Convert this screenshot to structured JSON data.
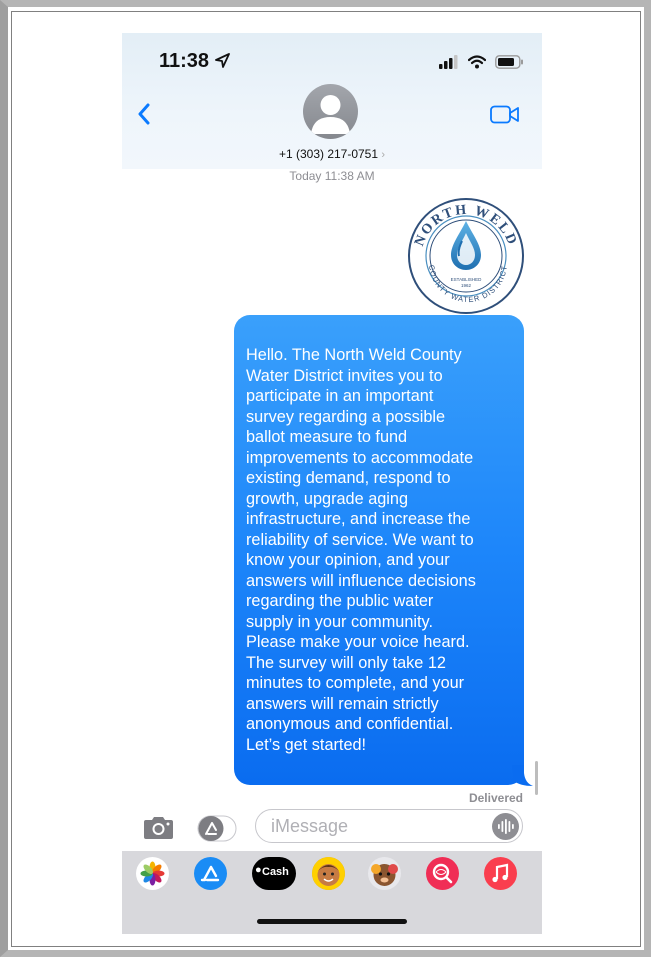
{
  "status_bar": {
    "time": "11:38"
  },
  "header": {
    "contact_number": "+1 (303) 217-0751",
    "chevron": "›"
  },
  "conversation": {
    "timestamp": "Today 11:38 AM",
    "logo": {
      "top_text": "NORTH WELD",
      "bottom_text": "COUNTY WATER DISTRICT",
      "established": "ESTABLISHED",
      "year": "1962",
      "colors": {
        "ring": "#2f4f7a",
        "drop": "#3a8fc9"
      }
    },
    "message": {
      "lines": [
        "Hello. The North Weld County",
        "Water District invites you to",
        "participate in an important",
        "survey regarding a possible",
        "ballot measure to fund",
        "improvements to accommodate",
        "existing demand, respond to",
        "growth, upgrade aging",
        "infrastructure, and increase the",
        "reliability of service. We want to",
        "know your opinion, and your",
        "answers will influence decisions",
        "regarding the public water",
        "supply in your community.",
        "Please make your voice heard.",
        "The survey will only take 12",
        "minutes to complete, and your",
        "answers will remain strictly",
        "anonymous and confidential.",
        "Let’s get started!"
      ],
      "bubble_color": "#1d86fa"
    },
    "delivery_status": "Delivered"
  },
  "composer": {
    "placeholder": "iMessage"
  },
  "app_tray": {
    "items": [
      {
        "name": "photos-app-icon",
        "label": ""
      },
      {
        "name": "app-store-icon",
        "label": ""
      },
      {
        "name": "apple-cash-icon",
        "label": "Cash"
      },
      {
        "name": "memoji-icon",
        "label": ""
      },
      {
        "name": "animoji-icon",
        "label": ""
      },
      {
        "name": "web-search-icon",
        "label": ""
      },
      {
        "name": "music-icon",
        "label": ""
      }
    ]
  }
}
